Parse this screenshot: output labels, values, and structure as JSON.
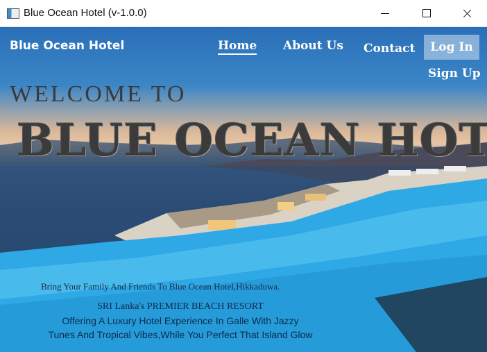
{
  "window": {
    "title": "Blue Ocean Hotel (v-1.0.0)",
    "icon": "app-window-icon",
    "controls": [
      "minimize-icon",
      "maximize-icon",
      "close-icon"
    ]
  },
  "nav": {
    "brand": "Blue Ocean Hotel",
    "home": "Home",
    "about": "About Us",
    "contact": "Contact",
    "login": "Log In",
    "signup": "Sign Up"
  },
  "hero": {
    "welcome": "WELCOME TO",
    "name": "BLUE OCEAN HOTEL",
    "tagline": "Bring Your Family And Friends To Blue Ocean Hotel,Hikkaduwa.",
    "line1": "SRI Lanka's PREMIER BEACH RESORT",
    "line2": "Offering A Luxury Hotel Experience In Galle With Jazzy",
    "line3": "Tunes And Tropical Vibes,While You Perfect That Island Glow"
  },
  "colors": {
    "sky": "#3b86c7",
    "sunset": "#e7c6a4",
    "sea": "#2c4f78",
    "pool": "#2ea9e6"
  }
}
